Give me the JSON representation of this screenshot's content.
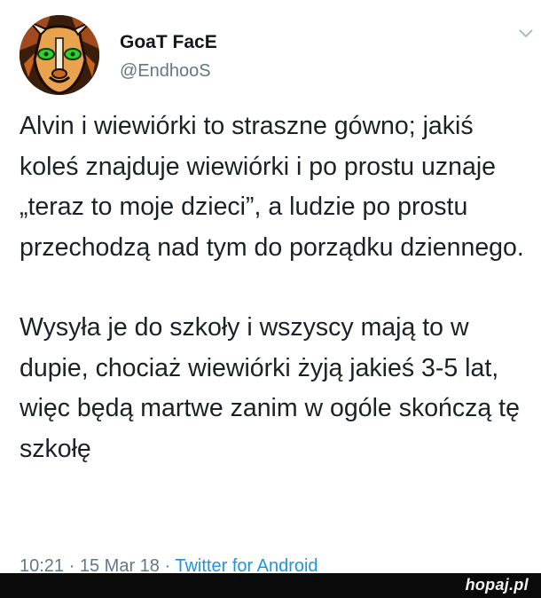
{
  "tweet": {
    "display_name": "GoaT FacE",
    "handle": "@EndhooS",
    "paragraphs": [
      "Alvin i wiewiórki to straszne gówno; jakiś koleś znajduje wiewiórki i po prostu uznaje „teraz to moje dzieci”, a ludzie po prostu przechodzą nad tym do porządku dziennego.",
      "Wysyła je do szkoły i wszyscy mają to w dupie, chociaż wiewiórki żyją jakieś 3-5 lat, więc będą martwe zanim w ogóle skończą tę szkołę"
    ],
    "time": "10:21",
    "date": "15 Mar 18",
    "separator": "·",
    "client": "Twitter for Android",
    "menu_icon": "chevron-down-icon",
    "avatar_icon": "goat-face-avatar"
  },
  "watermark": {
    "brand": "hopaj.pl"
  },
  "colors": {
    "name": "#14171a",
    "secondary": "#657786",
    "link": "#1b95e0",
    "footer_bg": "#0a0a0a"
  }
}
